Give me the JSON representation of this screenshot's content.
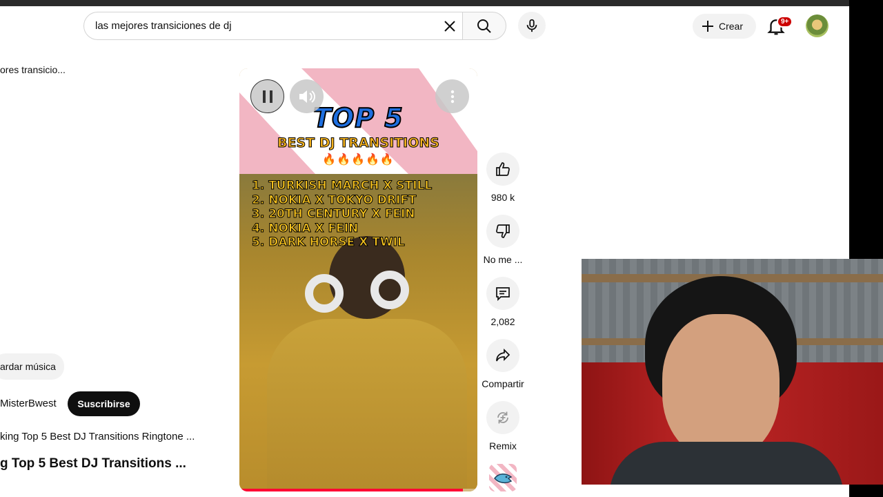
{
  "header": {
    "search_value": "las mejores transiciones de dj",
    "create_label": "Crear",
    "notif_badge": "9+"
  },
  "left_panel": {
    "search_snippet": "ores transicio...",
    "save_music_label": "ardar música",
    "channel_name": "MisterBwest",
    "subscribe_label": "Suscribirse",
    "audio_title": "king Top 5 Best DJ Transitions Ringtone ...",
    "short_title": "g Top 5 Best DJ Transitions ..."
  },
  "video": {
    "overlay_title": "TOP 5",
    "overlay_subtitle": "BEST DJ TRANSITIONS",
    "fire_emojis": "🔥🔥🔥🔥🔥",
    "list": [
      "1. TURKISH MARCH X STILL",
      "2. NOKIA X TOKYO DRIFT",
      "3. 20TH CENTURY X FEIN",
      "4. NOKIA X FEIN",
      "5. DARK HORSE X TWIL"
    ],
    "progress": 0.94
  },
  "actions": {
    "like_count": "980 k",
    "dislike_label": "No me ...",
    "comment_count": "2,082",
    "share_label": "Compartir",
    "remix_label": "Remix"
  },
  "colors": {
    "accent_red": "#ff0033",
    "badge_red": "#cc0000",
    "subscribe_bg": "#0f0f0f",
    "chip_bg": "#f2f2f2"
  }
}
